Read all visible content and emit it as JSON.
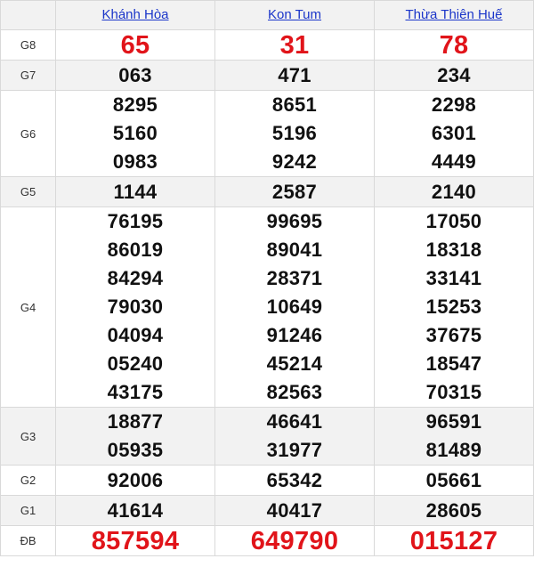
{
  "header": {
    "provinces": [
      "Khánh Hòa",
      "Kon Tum",
      "Thừa Thiên Huế"
    ]
  },
  "colors": {
    "link": "#1a35c9",
    "special_numbers": "#e1141a",
    "row_alt_bg": "#f2f2f2",
    "border": "#d9d9d9"
  },
  "prizes": [
    {
      "label": "G8",
      "values": [
        [
          "65"
        ],
        [
          "31"
        ],
        [
          "78"
        ]
      ]
    },
    {
      "label": "G7",
      "values": [
        [
          "063"
        ],
        [
          "471"
        ],
        [
          "234"
        ]
      ]
    },
    {
      "label": "G6",
      "values": [
        [
          "8295",
          "5160",
          "0983"
        ],
        [
          "8651",
          "5196",
          "9242"
        ],
        [
          "2298",
          "6301",
          "4449"
        ]
      ]
    },
    {
      "label": "G5",
      "values": [
        [
          "1144"
        ],
        [
          "2587"
        ],
        [
          "2140"
        ]
      ]
    },
    {
      "label": "G4",
      "values": [
        [
          "76195",
          "86019",
          "84294",
          "79030",
          "04094",
          "05240",
          "43175"
        ],
        [
          "99695",
          "89041",
          "28371",
          "10649",
          "91246",
          "45214",
          "82563"
        ],
        [
          "17050",
          "18318",
          "33141",
          "15253",
          "37675",
          "18547",
          "70315"
        ]
      ]
    },
    {
      "label": "G3",
      "values": [
        [
          "18877",
          "05935"
        ],
        [
          "46641",
          "31977"
        ],
        [
          "96591",
          "81489"
        ]
      ]
    },
    {
      "label": "G2",
      "values": [
        [
          "92006"
        ],
        [
          "65342"
        ],
        [
          "05661"
        ]
      ]
    },
    {
      "label": "G1",
      "values": [
        [
          "41614"
        ],
        [
          "40417"
        ],
        [
          "28605"
        ]
      ]
    },
    {
      "label": "ĐB",
      "values": [
        [
          "857594"
        ],
        [
          "649790"
        ],
        [
          "015127"
        ]
      ]
    }
  ]
}
